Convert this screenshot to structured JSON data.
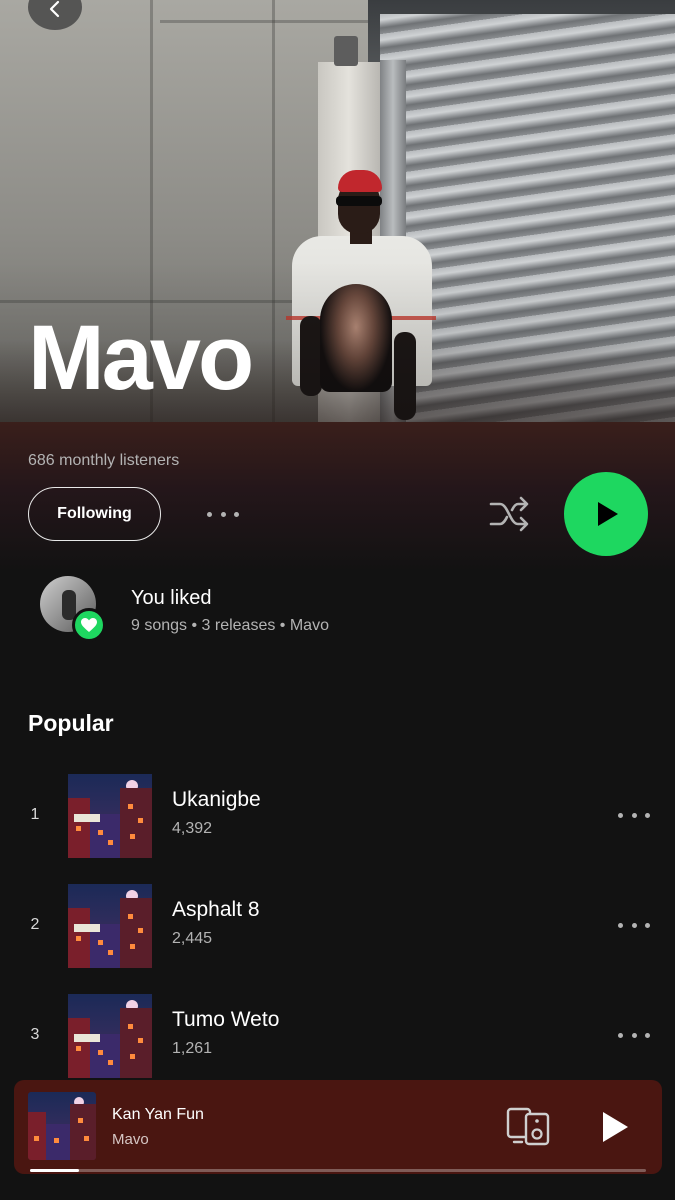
{
  "artist": {
    "name": "Mavo",
    "monthly_listeners": "686 monthly listeners"
  },
  "actions": {
    "follow_label": "Following"
  },
  "liked": {
    "title": "You liked",
    "subtitle": "9 songs • 3 releases • Mavo"
  },
  "popular": {
    "title": "Popular",
    "tracks": [
      {
        "rank": "1",
        "title": "Ukanigbe",
        "plays": "4,392"
      },
      {
        "rank": "2",
        "title": "Asphalt 8",
        "plays": "2,445"
      },
      {
        "rank": "3",
        "title": "Tumo Weto",
        "plays": "1,261"
      }
    ]
  },
  "now_playing": {
    "title": "Kan Yan Fun",
    "artist": "Mavo",
    "progress": 0.08
  },
  "colors": {
    "accent": "#1ed760",
    "background": "#121212",
    "mini_player": "#4a1611"
  },
  "icons": {
    "back": "chevron-left-icon",
    "more": "more-horizontal-icon",
    "shuffle": "shuffle-icon",
    "play": "play-icon",
    "heart": "heart-icon",
    "devices": "connect-device-icon"
  }
}
